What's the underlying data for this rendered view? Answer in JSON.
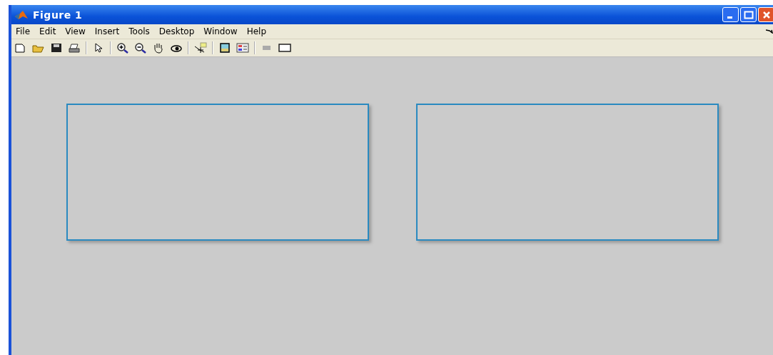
{
  "window": {
    "title": "Figure 1"
  },
  "menu": [
    "File",
    "Edit",
    "View",
    "Insert",
    "Tools",
    "Desktop",
    "Window",
    "Help"
  ],
  "toolbar": [
    {
      "kind": "new"
    },
    {
      "kind": "open"
    },
    {
      "kind": "save"
    },
    {
      "kind": "print"
    },
    {
      "kind": "sep"
    },
    {
      "kind": "pointer"
    },
    {
      "kind": "sep"
    },
    {
      "kind": "zoomin"
    },
    {
      "kind": "zoomout"
    },
    {
      "kind": "pan"
    },
    {
      "kind": "rotate"
    },
    {
      "kind": "sep"
    },
    {
      "kind": "datacursor"
    },
    {
      "kind": "sep"
    },
    {
      "kind": "colorbar"
    },
    {
      "kind": "legend"
    },
    {
      "kind": "sep"
    },
    {
      "kind": "hideplot"
    },
    {
      "kind": "showplot"
    }
  ],
  "axes": [
    {
      "kind": "empty"
    },
    {
      "kind": "empty"
    }
  ]
}
